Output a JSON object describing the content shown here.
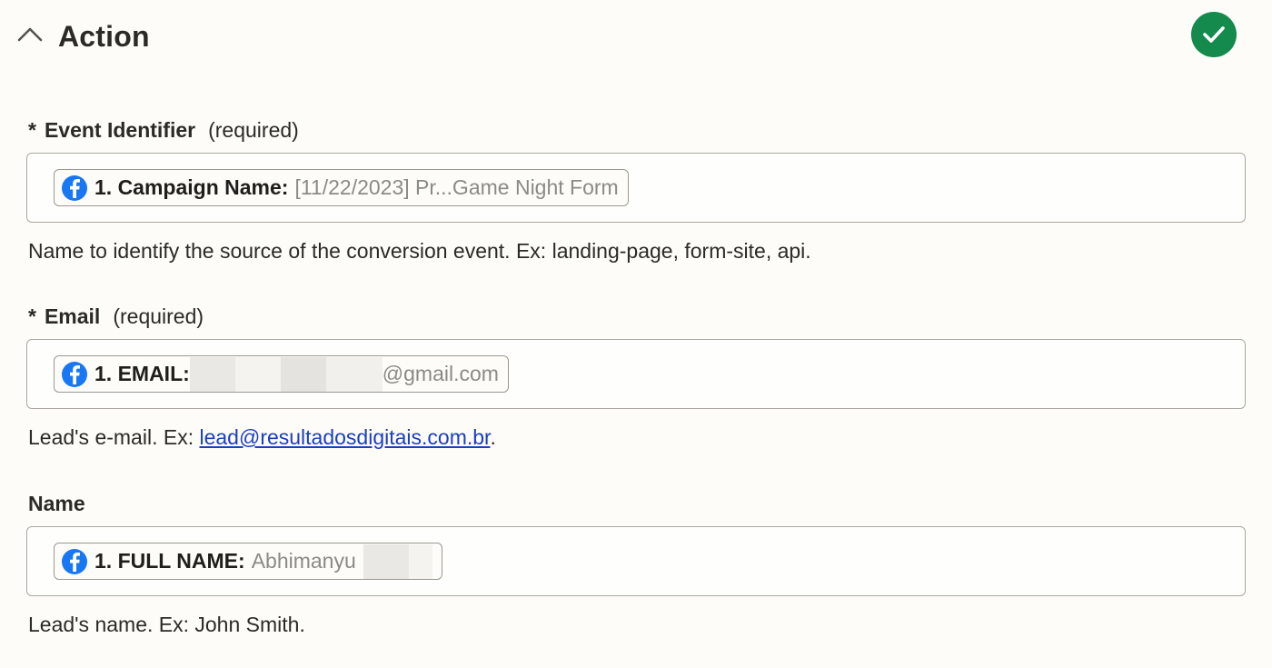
{
  "section": {
    "title": "Action",
    "status": "complete",
    "status_color": "#158a4d"
  },
  "fields": [
    {
      "asterisk": "*",
      "label": "Event Identifier",
      "required_text": "(required)",
      "pill_source_icon": "facebook-icon",
      "pill_key": "1. Campaign Name:",
      "pill_value": "[11/22/2023] Pr...Game Night Form",
      "help": "Name to identify the source of the conversion event. Ex: landing-page, form-site, api."
    },
    {
      "asterisk": "*",
      "label": "Email",
      "required_text": "(required)",
      "pill_source_icon": "facebook-icon",
      "pill_key": "1. EMAIL:",
      "pill_value_suffix": "@gmail.com",
      "help_prefix": "Lead's e-mail. Ex: ",
      "help_link": "lead@resultadosdigitais.com.br",
      "help_suffix": "."
    },
    {
      "label": "Name",
      "pill_source_icon": "facebook-icon",
      "pill_key": "1. FULL NAME:",
      "pill_value": "Abhimanyu",
      "help": "Lead's name. Ex: John Smith."
    }
  ],
  "colors": {
    "background": "#fdfcf9",
    "facebook_blue": "#1877f2",
    "link": "#1a3fbf"
  }
}
